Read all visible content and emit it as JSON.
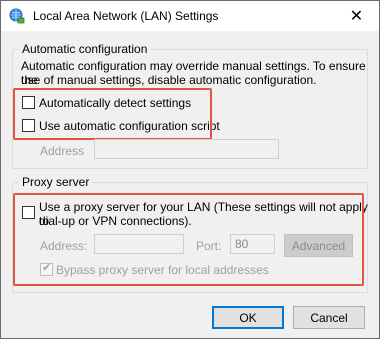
{
  "window": {
    "title": "Local Area Network (LAN) Settings",
    "close_glyph": "✕"
  },
  "automatic": {
    "legend": "Automatic configuration",
    "description_line1": "Automatic configuration may override manual settings.  To ensure the",
    "description_line2": "use of manual settings, disable automatic configuration.",
    "detect_label": "Automatically detect settings",
    "detect_checked": false,
    "script_label": "Use automatic configuration script",
    "script_checked": false,
    "address_label": "Address",
    "address_value": ""
  },
  "proxy": {
    "legend": "Proxy server",
    "use_proxy_line1": "Use a proxy server for your LAN (These settings will not apply to",
    "use_proxy_line2": "dial-up or VPN connections).",
    "use_proxy_checked": false,
    "address_label": "Address:",
    "address_value": "",
    "port_label": "Port:",
    "port_value": "80",
    "advanced_label": "Advanced",
    "bypass_label": "Bypass proxy server for local addresses",
    "bypass_checked": true
  },
  "buttons": {
    "ok": "OK",
    "cancel": "Cancel"
  },
  "colors": {
    "highlight": "#e05545",
    "accent": "#0078d7"
  }
}
